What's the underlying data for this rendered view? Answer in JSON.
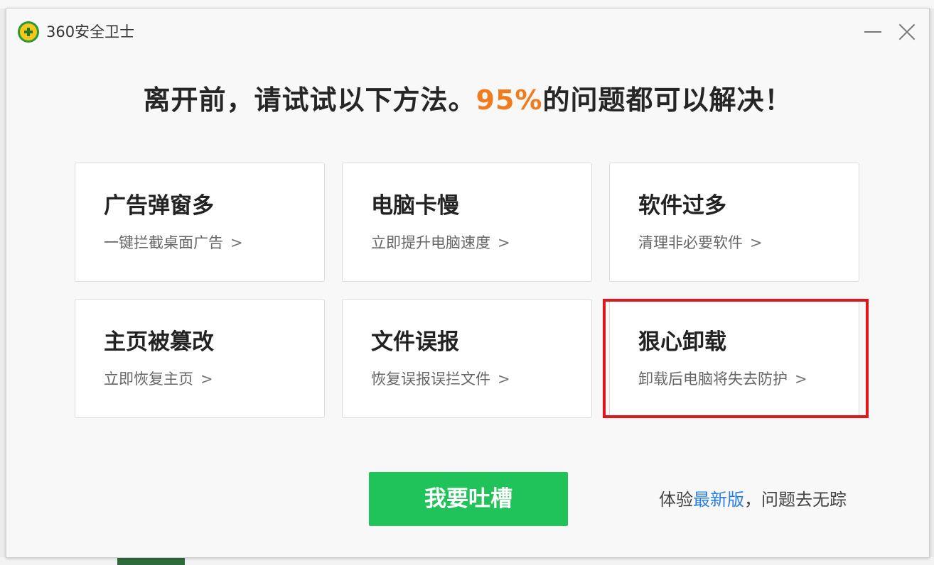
{
  "window": {
    "title": "360安全卫士"
  },
  "headline": {
    "before": "离开前，请试试以下方法。",
    "highlight": "95%",
    "after": "的问题都可以解决！"
  },
  "cards": [
    {
      "title": "广告弹窗多",
      "subtitle": "一键拦截桌面广告",
      "arrow": ">"
    },
    {
      "title": "电脑卡慢",
      "subtitle": "立即提升电脑速度",
      "arrow": ">"
    },
    {
      "title": "软件过多",
      "subtitle": "清理非必要软件",
      "arrow": ">"
    },
    {
      "title": "主页被篡改",
      "subtitle": "立即恢复主页",
      "arrow": ">"
    },
    {
      "title": "文件误报",
      "subtitle": "恢复误报误拦文件",
      "arrow": ">"
    },
    {
      "title": "狠心卸载",
      "subtitle": "卸载后电脑将失去防护",
      "arrow": ">"
    }
  ],
  "feedback_button": {
    "label": "我要吐槽"
  },
  "footer": {
    "prefix": "体验",
    "link": "最新版",
    "suffix": "，问题去无踪"
  },
  "colors": {
    "accent_orange": "#f07c1f",
    "button_green": "#1fc35a",
    "link_blue": "#2b7fe0",
    "highlight_red": "#e0161a"
  }
}
